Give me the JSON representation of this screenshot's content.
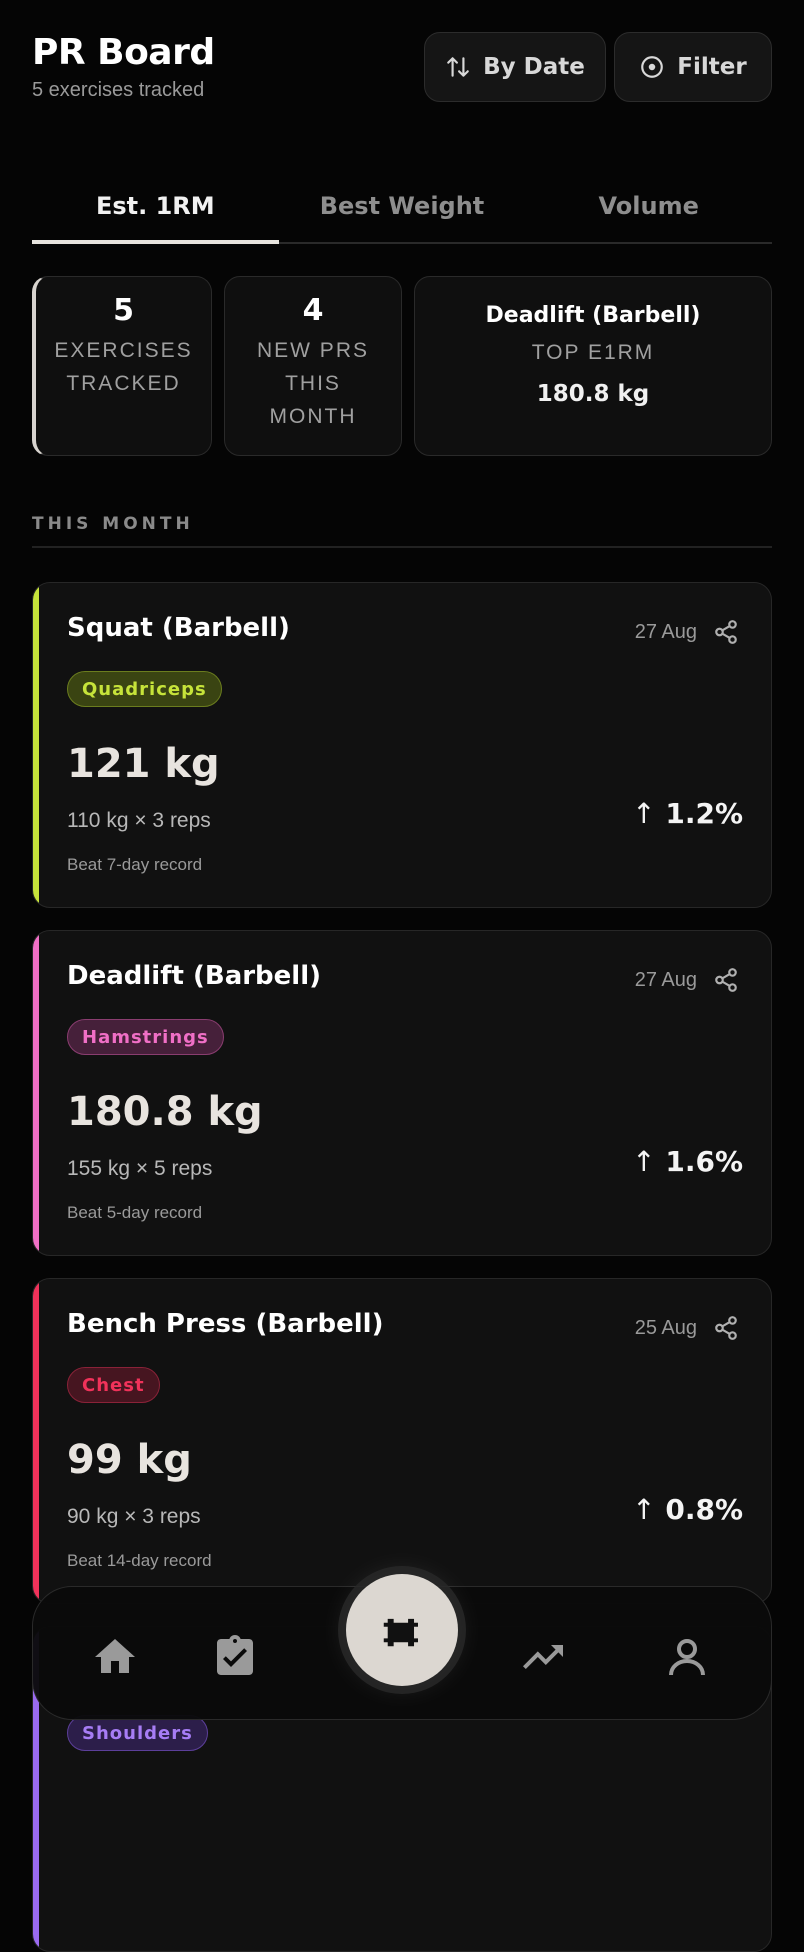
{
  "header": {
    "title": "PR Board",
    "subtitle": "5 exercises tracked"
  },
  "actions": {
    "sort_label": "By Date",
    "filter_label": "Filter"
  },
  "tabs": [
    {
      "label": "Est. 1RM",
      "active": true
    },
    {
      "label": "Best Weight",
      "active": false
    },
    {
      "label": "Volume",
      "active": false
    }
  ],
  "stats": {
    "exercises": {
      "value": "5",
      "label_line1": "EXERCISES",
      "label_line2": "TRACKED"
    },
    "new_prs": {
      "value": "4",
      "label_line1": "NEW PRS",
      "label_line2": "THIS",
      "label_line3": "MONTH"
    },
    "top": {
      "exercise": "Deadlift (Barbell)",
      "label": "TOP E1RM",
      "value": "180.8 kg"
    }
  },
  "section_title": "THIS MONTH",
  "cards": [
    {
      "name": "Squat (Barbell)",
      "date": "27 Aug",
      "muscle": "Quadriceps",
      "e1rm": "121 kg",
      "detail": "110 kg × 3 reps",
      "beat": "Beat 7-day record",
      "change": "1.2%",
      "color": "#c6e33a"
    },
    {
      "name": "Deadlift (Barbell)",
      "date": "27 Aug",
      "muscle": "Hamstrings",
      "e1rm": "180.8 kg",
      "detail": "155 kg × 5 reps",
      "beat": "Beat 5-day record",
      "change": "1.6%",
      "color": "#f06fc6"
    },
    {
      "name": "Bench Press (Barbell)",
      "date": "25 Aug",
      "muscle": "Chest",
      "e1rm": "99 kg",
      "detail": "90 kg × 3 reps",
      "beat": "Beat 14-day record",
      "change": "0.8%",
      "color": "#f0325a"
    },
    {
      "name": "",
      "muscle": "Shoulders",
      "color": "#9a6af0"
    }
  ],
  "nav": {
    "icons": [
      "home-icon",
      "clipboard-check-icon",
      "dumbbell-icon",
      "trending-up-icon",
      "person-icon"
    ]
  }
}
